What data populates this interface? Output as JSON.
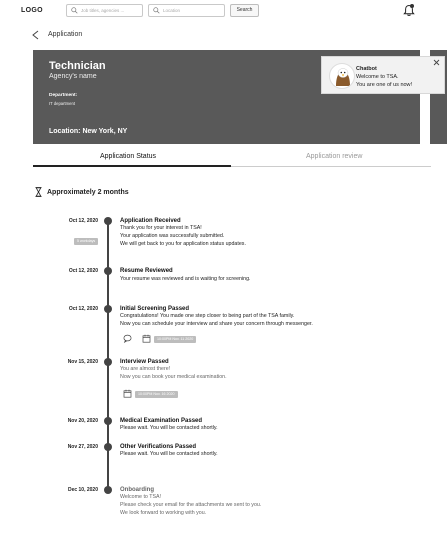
{
  "header": {
    "logo": "LOGO",
    "job_search_placeholder": "Job titles, agencies ...",
    "location_placeholder": "Location",
    "search_button": "Search"
  },
  "page": {
    "title": "Application"
  },
  "job": {
    "title": "Technician",
    "agency": "Agency's name",
    "department_label": "Department:",
    "department": "IT department",
    "location": "Location: New York, NY"
  },
  "chatbot": {
    "name": "Chatbot",
    "line1": "Welcome to TSA.",
    "line2": "You are one of us now!"
  },
  "tabs": {
    "status": "Application Status",
    "review": "Application review"
  },
  "duration": "Approximately 2 months",
  "timeline": [
    {
      "date": "Oct 12, 2020",
      "title": "Application Received",
      "lines": [
        "Thank you for your interest in TSA!",
        "Your application was successfully submitted.",
        "We will get back to you for application status updates."
      ],
      "chip": "5 workdays"
    },
    {
      "date": "Oct 12, 2020",
      "title": "Resume Reviewed",
      "lines": [
        "Your resume was reviewed and is waiting for screening."
      ]
    },
    {
      "date": "Oct 12, 2020",
      "title": "Initial Screening Passed",
      "lines": [
        "Congratulations! You made one step closer to being part of the TSA family.",
        "Now you can schedule your interview and share your concern through messenger."
      ],
      "chip": "10:00PM  Nov. 11 2020"
    },
    {
      "date": "Nov 15, 2020",
      "title": "Interview Passed",
      "lines": [
        "You are almost there!",
        "Now you can book your medical examination."
      ],
      "chip": "10:00PM  Nov. 16 2020"
    },
    {
      "date": "Nov 20, 2020",
      "title": "Medical Examination Passed",
      "lines": [
        "Please wait. You will be contacted shortly."
      ]
    },
    {
      "date": "Nov 27, 2020",
      "title": "Other Verifications Passed",
      "lines": [
        "Please wait. You will be contacted shortly."
      ]
    },
    {
      "date": "Dec 10, 2020",
      "title": "Onboarding",
      "lines": [
        "Welcome to TSA!",
        "Please check your email for the attachments we sent to you.",
        "We look forward to working with you."
      ]
    }
  ],
  "colors": {
    "banner": "#595959",
    "accent": "#444444",
    "chip": "#bdbdbd"
  }
}
